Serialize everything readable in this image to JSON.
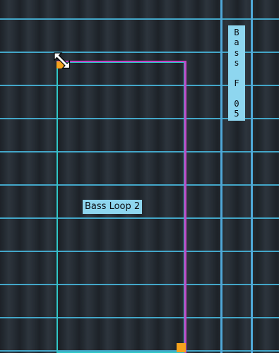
{
  "clips": {
    "main": {
      "label": "Bass Loop 2"
    },
    "side": {
      "label_chars": [
        "B",
        "a",
        "s",
        "s",
        "",
        "F",
        "",
        "0",
        "5"
      ]
    }
  },
  "colors": {
    "grid_line": "#43a6c8",
    "clip_selected_border": "#c246c6",
    "clip_border": "#2fc6c6",
    "label_background": "#8ed6ef",
    "handle": "#f5a21c"
  },
  "icons": {
    "cursor": "resize-diagonal-icon",
    "corner_handle": "resize-handle-icon"
  }
}
